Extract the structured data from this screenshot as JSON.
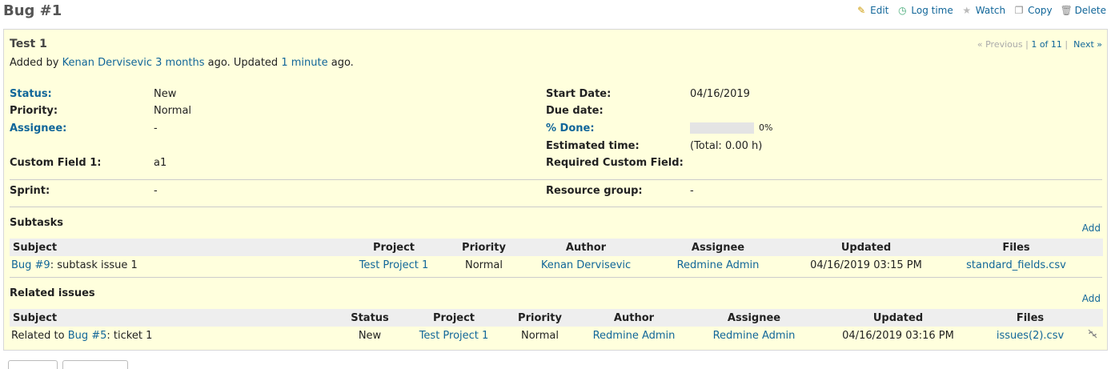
{
  "page": {
    "title": "Bug #1"
  },
  "actions": [
    {
      "label": "Edit"
    },
    {
      "label": "Log time"
    },
    {
      "label": "Watch"
    },
    {
      "label": "Copy"
    },
    {
      "label": "Delete"
    }
  ],
  "issue": {
    "subject": "Test 1",
    "nav": {
      "previous": "« Previous",
      "position": "1 of 11",
      "next": "Next »",
      "sep": "|"
    },
    "added_by_prefix": "Added by",
    "author": "Kenan Dervisevic",
    "created_ago": "3 months",
    "updated_mid": "ago. Updated",
    "updated_ago": "1 minute",
    "updated_suffix": "ago."
  },
  "attributes": {
    "status_label": "Status:",
    "status_value": "New",
    "priority_label": "Priority:",
    "priority_value": "Normal",
    "assignee_label": "Assignee:",
    "assignee_value": "-",
    "custom1_label": "Custom Field 1:",
    "custom1_value": "a1",
    "start_label": "Start Date:",
    "start_value": "04/16/2019",
    "due_label": "Due date:",
    "due_value": "",
    "done_label": "% Done:",
    "done_value": "0%",
    "done_fraction": 0,
    "estimated_label": "Estimated time:",
    "estimated_value": "(Total: 0.00 h)",
    "required_label": "Required Custom Field:",
    "required_value": "",
    "sprint_label": "Sprint:",
    "sprint_value": "-",
    "resource_label": "Resource group:",
    "resource_value": "-"
  },
  "subtasks": {
    "heading": "Subtasks",
    "add": "Add",
    "columns": [
      "Subject",
      "Project",
      "Priority",
      "Author",
      "Assignee",
      "Updated",
      "Files"
    ],
    "rows": [
      {
        "subject_link": "Bug #9",
        "subject_text": ": subtask issue 1",
        "project": "Test Project 1",
        "priority": "Normal",
        "author": "Kenan Dervisevic",
        "assignee": "Redmine Admin",
        "updated": "04/16/2019 03:15 PM",
        "files": "standard_fields.csv"
      }
    ]
  },
  "related": {
    "heading": "Related issues",
    "add": "Add",
    "columns": [
      "Subject",
      "Status",
      "Project",
      "Priority",
      "Author",
      "Assignee",
      "Updated",
      "Files"
    ],
    "rows": [
      {
        "relation": "Related to ",
        "subject_link": "Bug #5",
        "subject_text": ": ticket 1",
        "status": "New",
        "project": "Test Project 1",
        "priority": "Normal",
        "author": "Redmine Admin",
        "assignee": "Redmine Admin",
        "updated": "04/16/2019 03:16 PM",
        "files": "issues(2).csv"
      }
    ]
  }
}
